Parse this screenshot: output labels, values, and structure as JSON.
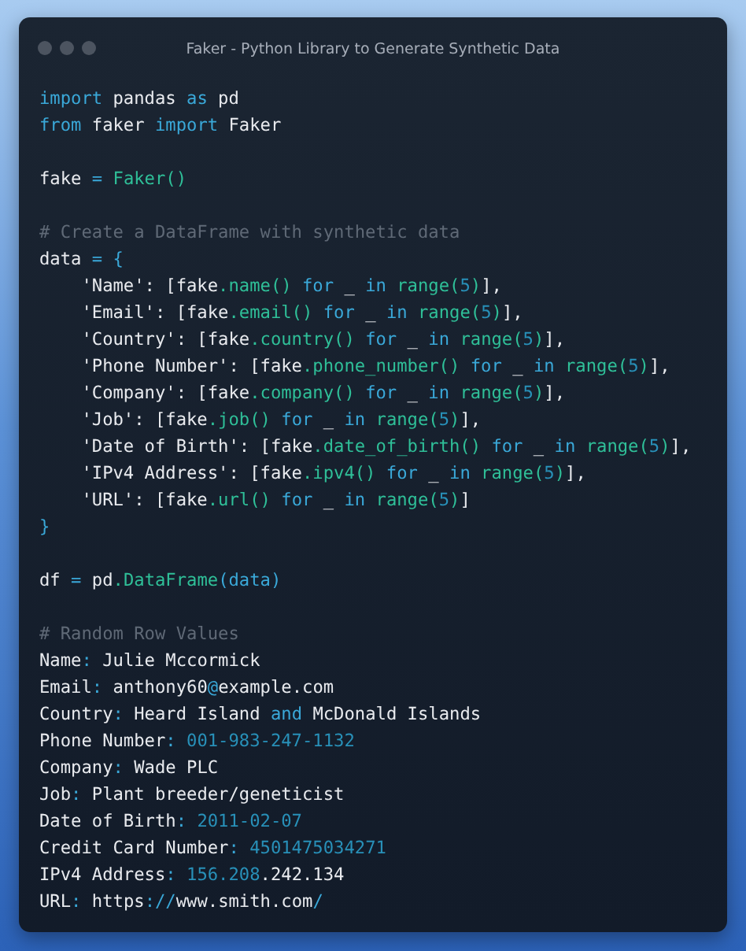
{
  "window": {
    "title": "Faker - Python Library to Generate Synthetic Data"
  },
  "code_blocks": [
    [
      [
        {
          "text": "import",
          "kind": "kw"
        },
        {
          "text": " pandas ",
          "kind": "plain"
        },
        {
          "text": "as",
          "kind": "kw"
        },
        {
          "text": " pd",
          "kind": "plain"
        }
      ],
      [
        {
          "text": "from",
          "kind": "kw"
        },
        {
          "text": " faker ",
          "kind": "plain"
        },
        {
          "text": "import",
          "kind": "kw"
        },
        {
          "text": " Faker",
          "kind": "plain"
        }
      ]
    ],
    [
      [
        {
          "text": "fake ",
          "kind": "plain"
        },
        {
          "text": "= ",
          "kind": "op"
        },
        {
          "text": "Faker()",
          "kind": "fn"
        }
      ]
    ],
    [
      [
        {
          "text": "# Create a DataFrame with synthetic data",
          "kind": "comment"
        }
      ],
      [
        {
          "text": "data ",
          "kind": "plain"
        },
        {
          "text": "= {",
          "kind": "op"
        }
      ],
      [
        {
          "text": "    'Name': [fake",
          "kind": "plain"
        },
        {
          "text": ".name() ",
          "kind": "fn"
        },
        {
          "text": "for",
          "kind": "kw"
        },
        {
          "text": " _ ",
          "kind": "plain"
        },
        {
          "text": "in",
          "kind": "kw"
        },
        {
          "text": " range(",
          "kind": "fn"
        },
        {
          "text": "5",
          "kind": "num"
        },
        {
          "text": ")",
          "kind": "fn"
        },
        {
          "text": "],",
          "kind": "plain"
        }
      ],
      [
        {
          "text": "    'Email': [fake",
          "kind": "plain"
        },
        {
          "text": ".email() ",
          "kind": "fn"
        },
        {
          "text": "for",
          "kind": "kw"
        },
        {
          "text": " _ ",
          "kind": "plain"
        },
        {
          "text": "in",
          "kind": "kw"
        },
        {
          "text": " range(",
          "kind": "fn"
        },
        {
          "text": "5",
          "kind": "num"
        },
        {
          "text": ")",
          "kind": "fn"
        },
        {
          "text": "],",
          "kind": "plain"
        }
      ],
      [
        {
          "text": "    'Country': [fake",
          "kind": "plain"
        },
        {
          "text": ".country() ",
          "kind": "fn"
        },
        {
          "text": "for",
          "kind": "kw"
        },
        {
          "text": " _ ",
          "kind": "plain"
        },
        {
          "text": "in",
          "kind": "kw"
        },
        {
          "text": " range(",
          "kind": "fn"
        },
        {
          "text": "5",
          "kind": "num"
        },
        {
          "text": ")",
          "kind": "fn"
        },
        {
          "text": "],",
          "kind": "plain"
        }
      ],
      [
        {
          "text": "    'Phone Number': [fake",
          "kind": "plain"
        },
        {
          "text": ".phone_number() ",
          "kind": "fn"
        },
        {
          "text": "for",
          "kind": "kw"
        },
        {
          "text": " _ ",
          "kind": "plain"
        },
        {
          "text": "in",
          "kind": "kw"
        },
        {
          "text": " range(",
          "kind": "fn"
        },
        {
          "text": "5",
          "kind": "num"
        },
        {
          "text": ")",
          "kind": "fn"
        },
        {
          "text": "],",
          "kind": "plain"
        }
      ],
      [
        {
          "text": "    'Company': [fake",
          "kind": "plain"
        },
        {
          "text": ".company() ",
          "kind": "fn"
        },
        {
          "text": "for",
          "kind": "kw"
        },
        {
          "text": " _ ",
          "kind": "plain"
        },
        {
          "text": "in",
          "kind": "kw"
        },
        {
          "text": " range(",
          "kind": "fn"
        },
        {
          "text": "5",
          "kind": "num"
        },
        {
          "text": ")",
          "kind": "fn"
        },
        {
          "text": "],",
          "kind": "plain"
        }
      ],
      [
        {
          "text": "    'Job': [fake",
          "kind": "plain"
        },
        {
          "text": ".job() ",
          "kind": "fn"
        },
        {
          "text": "for",
          "kind": "kw"
        },
        {
          "text": " _ ",
          "kind": "plain"
        },
        {
          "text": "in",
          "kind": "kw"
        },
        {
          "text": " range(",
          "kind": "fn"
        },
        {
          "text": "5",
          "kind": "num"
        },
        {
          "text": ")",
          "kind": "fn"
        },
        {
          "text": "],",
          "kind": "plain"
        }
      ],
      [
        {
          "text": "    'Date of Birth': [fake",
          "kind": "plain"
        },
        {
          "text": ".date_of_birth() ",
          "kind": "fn"
        },
        {
          "text": "for",
          "kind": "kw"
        },
        {
          "text": " _ ",
          "kind": "plain"
        },
        {
          "text": "in",
          "kind": "kw"
        },
        {
          "text": " range(",
          "kind": "fn"
        },
        {
          "text": "5",
          "kind": "num"
        },
        {
          "text": ")",
          "kind": "fn"
        },
        {
          "text": "],",
          "kind": "plain"
        }
      ],
      [
        {
          "text": "    'IPv4 Address': [fake",
          "kind": "plain"
        },
        {
          "text": ".ipv4() ",
          "kind": "fn"
        },
        {
          "text": "for",
          "kind": "kw"
        },
        {
          "text": " _ ",
          "kind": "plain"
        },
        {
          "text": "in",
          "kind": "kw"
        },
        {
          "text": " range(",
          "kind": "fn"
        },
        {
          "text": "5",
          "kind": "num"
        },
        {
          "text": ")",
          "kind": "fn"
        },
        {
          "text": "],",
          "kind": "plain"
        }
      ],
      [
        {
          "text": "    'URL': [fake",
          "kind": "plain"
        },
        {
          "text": ".url() ",
          "kind": "fn"
        },
        {
          "text": "for",
          "kind": "kw"
        },
        {
          "text": " _ ",
          "kind": "plain"
        },
        {
          "text": "in",
          "kind": "kw"
        },
        {
          "text": " range(",
          "kind": "fn"
        },
        {
          "text": "5",
          "kind": "num"
        },
        {
          "text": ")",
          "kind": "fn"
        },
        {
          "text": "]",
          "kind": "plain"
        }
      ],
      [
        {
          "text": "}",
          "kind": "op"
        }
      ]
    ],
    [
      [
        {
          "text": "df ",
          "kind": "plain"
        },
        {
          "text": "=",
          "kind": "op"
        },
        {
          "text": " pd",
          "kind": "plain"
        },
        {
          "text": ".DataFrame",
          "kind": "fn"
        },
        {
          "text": "(data)",
          "kind": "op"
        }
      ]
    ],
    [
      [
        {
          "text": "# Random Row Values",
          "kind": "comment"
        }
      ],
      [
        {
          "text": "Name",
          "kind": "plain"
        },
        {
          "text": ":",
          "kind": "op"
        },
        {
          "text": " Julie Mccormick",
          "kind": "plain"
        }
      ],
      [
        {
          "text": "Email",
          "kind": "plain"
        },
        {
          "text": ":",
          "kind": "op"
        },
        {
          "text": " anthony60",
          "kind": "plain"
        },
        {
          "text": "@",
          "kind": "op"
        },
        {
          "text": "example.com",
          "kind": "plain"
        }
      ],
      [
        {
          "text": "Country",
          "kind": "plain"
        },
        {
          "text": ":",
          "kind": "op"
        },
        {
          "text": " Heard Island ",
          "kind": "plain"
        },
        {
          "text": "and",
          "kind": "kw"
        },
        {
          "text": " McDonald Islands",
          "kind": "plain"
        }
      ],
      [
        {
          "text": "Phone Number",
          "kind": "plain"
        },
        {
          "text": ": ",
          "kind": "op"
        },
        {
          "text": "001-983-247-1132",
          "kind": "num"
        }
      ],
      [
        {
          "text": "Company",
          "kind": "plain"
        },
        {
          "text": ":",
          "kind": "op"
        },
        {
          "text": " Wade PLC",
          "kind": "plain"
        }
      ],
      [
        {
          "text": "Job",
          "kind": "plain"
        },
        {
          "text": ":",
          "kind": "op"
        },
        {
          "text": " Plant breeder/geneticist",
          "kind": "plain"
        }
      ],
      [
        {
          "text": "Date of Birth",
          "kind": "plain"
        },
        {
          "text": ": ",
          "kind": "op"
        },
        {
          "text": "2011-02-07",
          "kind": "num"
        }
      ],
      [
        {
          "text": "Credit Card Number",
          "kind": "plain"
        },
        {
          "text": ": ",
          "kind": "op"
        },
        {
          "text": "4501475034271",
          "kind": "num"
        }
      ],
      [
        {
          "text": "IPv4 Address",
          "kind": "plain"
        },
        {
          "text": ": ",
          "kind": "op"
        },
        {
          "text": "156.208",
          "kind": "num"
        },
        {
          "text": ".242.134",
          "kind": "plain"
        }
      ],
      [
        {
          "text": "URL",
          "kind": "plain"
        },
        {
          "text": ":",
          "kind": "op"
        },
        {
          "text": " https",
          "kind": "plain"
        },
        {
          "text": "://",
          "kind": "op"
        },
        {
          "text": "www.smith.com",
          "kind": "plain"
        },
        {
          "text": "/",
          "kind": "op"
        }
      ]
    ]
  ]
}
